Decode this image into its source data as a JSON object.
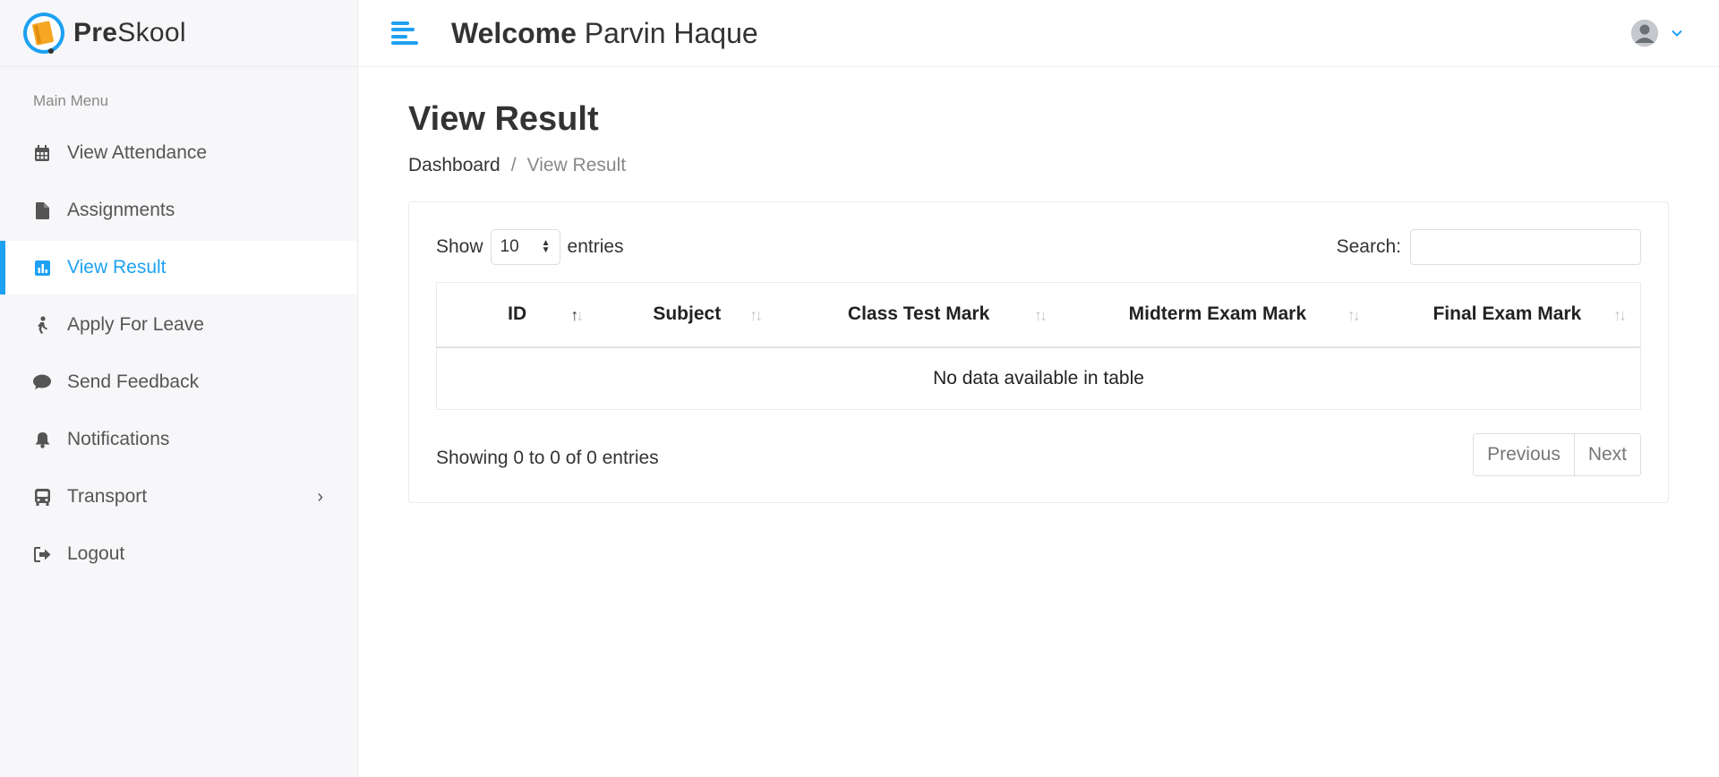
{
  "brand": {
    "pre": "Pre",
    "post": "Skool"
  },
  "header": {
    "welcome": "Welcome",
    "user_name": "Parvin Haque"
  },
  "sidebar": {
    "section_title": "Main Menu",
    "items": [
      {
        "label": "View Attendance",
        "icon": "calendar-icon",
        "active": false
      },
      {
        "label": "Assignments",
        "icon": "file-icon",
        "active": false
      },
      {
        "label": "View Result",
        "icon": "bar-chart-icon",
        "active": true
      },
      {
        "label": "Apply For Leave",
        "icon": "person-walk-icon",
        "active": false
      },
      {
        "label": "Send Feedback",
        "icon": "comment-icon",
        "active": false
      },
      {
        "label": "Notifications",
        "icon": "bell-icon",
        "active": false
      },
      {
        "label": "Transport",
        "icon": "bus-icon",
        "active": false,
        "submenu_arrow": "›"
      },
      {
        "label": "Logout",
        "icon": "sign-out-icon",
        "active": false
      }
    ]
  },
  "page": {
    "title": "View Result",
    "breadcrumb": {
      "home": "Dashboard",
      "separator": "/",
      "current": "View Result"
    }
  },
  "table_controls": {
    "show_label": "Show",
    "entries_value": "10",
    "entries_label": "entries",
    "search_label": "Search:",
    "search_value": ""
  },
  "table": {
    "columns": [
      "ID",
      "Subject",
      "Class Test Mark",
      "Midterm Exam Mark",
      "Final Exam Mark"
    ],
    "sorted_column": "ID",
    "sort_direction": "ascending",
    "empty_message": "No data available in table"
  },
  "footer": {
    "info": "Showing 0 to 0 of 0 entries",
    "prev_label": "Previous",
    "next_label": "Next"
  },
  "colors": {
    "accent": "#1da1f2",
    "sidebar_bg": "#f7f7fa",
    "logo_orange": "#f5a623"
  }
}
